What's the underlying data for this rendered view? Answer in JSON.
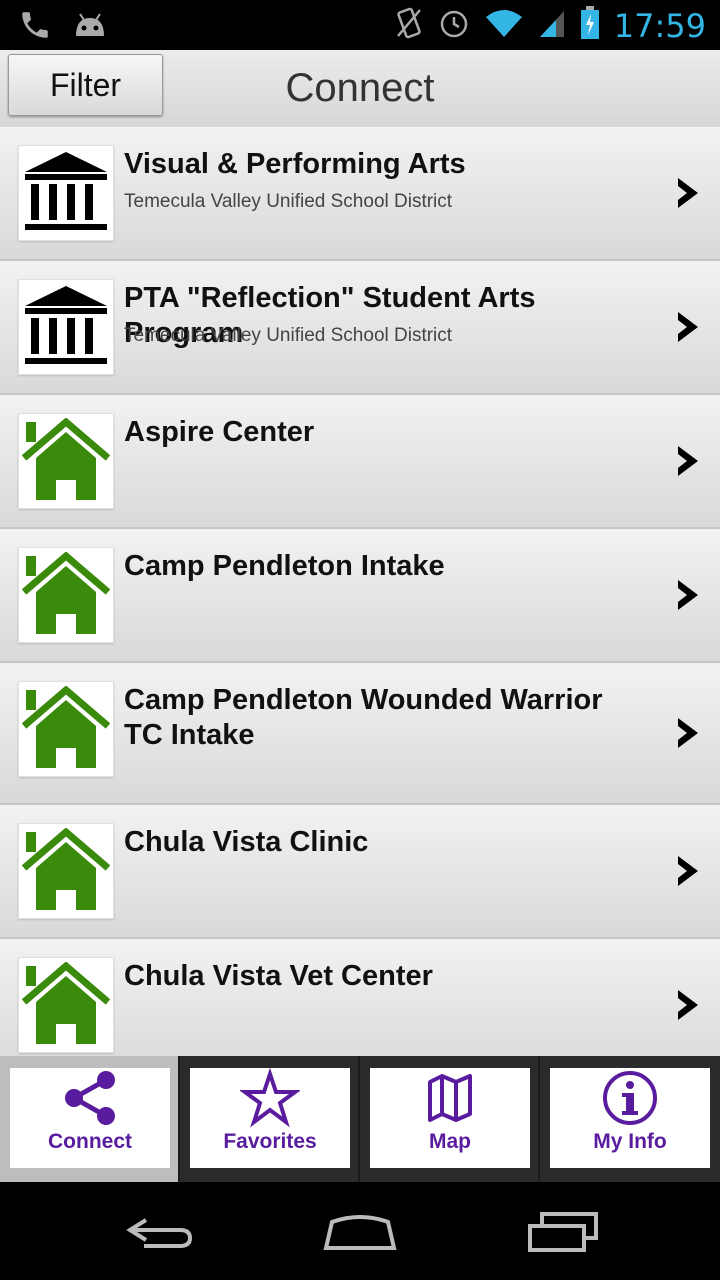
{
  "status_bar": {
    "time": "17:59"
  },
  "top_bar": {
    "filter_label": "Filter",
    "title": "Connect"
  },
  "list": {
    "items": [
      {
        "title": "Visual & Performing Arts",
        "subtitle": "Temecula Valley Unified School District",
        "icon": "institution-icon"
      },
      {
        "title": "PTA \"Reflection\" Student Arts Program",
        "subtitle": "Temecula Valley Unified School District",
        "icon": "institution-icon"
      },
      {
        "title": "Aspire Center",
        "subtitle": "",
        "icon": "house-icon"
      },
      {
        "title": "Camp Pendleton Intake",
        "subtitle": "",
        "icon": "house-icon"
      },
      {
        "title": "Camp Pendleton Wounded Warrior TC Intake",
        "subtitle": "",
        "icon": "house-icon"
      },
      {
        "title": "Chula Vista Clinic",
        "subtitle": "",
        "icon": "house-icon"
      },
      {
        "title": "Chula Vista Vet Center",
        "subtitle": "",
        "icon": "house-icon"
      }
    ]
  },
  "tab_bar": {
    "tabs": [
      {
        "label": "Connect",
        "icon": "share-icon",
        "active": true
      },
      {
        "label": "Favorites",
        "icon": "star-icon",
        "active": false
      },
      {
        "label": "Map",
        "icon": "map-icon",
        "active": false
      },
      {
        "label": "My Info",
        "icon": "info-icon",
        "active": false
      }
    ]
  },
  "colors": {
    "accent_purple": "#5a1c9e",
    "house_green": "#3a8a0c",
    "status_blue": "#33b5e5"
  }
}
